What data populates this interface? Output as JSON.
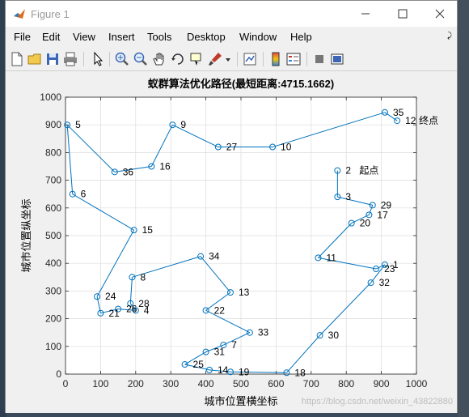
{
  "window": {
    "title": "Figure 1"
  },
  "menu": [
    "File",
    "Edit",
    "View",
    "Insert",
    "Tools",
    "Desktop",
    "Window",
    "Help"
  ],
  "toolbar_icons": [
    "new-figure-icon",
    "open-file-icon",
    "save-icon",
    "print-icon",
    "select-arrow-icon",
    "zoom-in-icon",
    "zoom-out-icon",
    "pan-hand-icon",
    "rotate-3d-icon",
    "data-cursor-icon",
    "brush-icon",
    "brush-dropdown-icon",
    "link-plot-icon",
    "colorbar-icon",
    "legend-icon",
    "hide-plot-tools-icon",
    "show-plot-tools-icon"
  ],
  "watermark": "https://blog.csdn.net/weixin_43822880",
  "chart_data": {
    "type": "line",
    "title": "蚁群算法优化路径(最短距离:4715.1662)",
    "xlabel": "城市位置横坐标",
    "ylabel": "城市位置纵坐标",
    "xlim": [
      0,
      1000
    ],
    "ylim": [
      0,
      1000
    ],
    "xticks": [
      "0",
      "100",
      "200",
      "300",
      "400",
      "500",
      "600",
      "700",
      "800",
      "900",
      "1000"
    ],
    "yticks": [
      "0",
      "100",
      "200",
      "300",
      "400",
      "500",
      "600",
      "700",
      "800",
      "900",
      "1000"
    ],
    "grid": true,
    "marker": "circle",
    "line_color": "#0072bd",
    "start_label": "起点",
    "end_label": "终点",
    "cities": [
      {
        "id": "1",
        "x": 910,
        "y": 395
      },
      {
        "id": "2",
        "x": 775,
        "y": 735
      },
      {
        "id": "3",
        "x": 775,
        "y": 640
      },
      {
        "id": "4",
        "x": 200,
        "y": 230
      },
      {
        "id": "5",
        "x": 5,
        "y": 900
      },
      {
        "id": "6",
        "x": 20,
        "y": 650
      },
      {
        "id": "7",
        "x": 450,
        "y": 105
      },
      {
        "id": "8",
        "x": 190,
        "y": 350
      },
      {
        "id": "9",
        "x": 305,
        "y": 900
      },
      {
        "id": "10",
        "x": 590,
        "y": 820
      },
      {
        "id": "11",
        "x": 720,
        "y": 420
      },
      {
        "id": "12",
        "x": 945,
        "y": 915
      },
      {
        "id": "13",
        "x": 470,
        "y": 295
      },
      {
        "id": "14",
        "x": 410,
        "y": 15
      },
      {
        "id": "15",
        "x": 195,
        "y": 520
      },
      {
        "id": "16",
        "x": 245,
        "y": 750
      },
      {
        "id": "17",
        "x": 865,
        "y": 575
      },
      {
        "id": "18",
        "x": 630,
        "y": 5
      },
      {
        "id": "19",
        "x": 470,
        "y": 8
      },
      {
        "id": "20",
        "x": 815,
        "y": 545
      },
      {
        "id": "21",
        "x": 100,
        "y": 220
      },
      {
        "id": "22",
        "x": 400,
        "y": 230
      },
      {
        "id": "23",
        "x": 885,
        "y": 380
      },
      {
        "id": "24",
        "x": 90,
        "y": 280
      },
      {
        "id": "25",
        "x": 340,
        "y": 35
      },
      {
        "id": "26",
        "x": 150,
        "y": 235
      },
      {
        "id": "27",
        "x": 435,
        "y": 820
      },
      {
        "id": "28",
        "x": 185,
        "y": 255
      },
      {
        "id": "29",
        "x": 875,
        "y": 610
      },
      {
        "id": "30",
        "x": 725,
        "y": 140
      },
      {
        "id": "31",
        "x": 400,
        "y": 80
      },
      {
        "id": "32",
        "x": 870,
        "y": 330
      },
      {
        "id": "33",
        "x": 525,
        "y": 150
      },
      {
        "id": "34",
        "x": 385,
        "y": 425
      },
      {
        "id": "35",
        "x": 910,
        "y": 945
      },
      {
        "id": "36",
        "x": 140,
        "y": 730
      }
    ],
    "route": [
      "2",
      "3",
      "29",
      "17",
      "20",
      "11",
      "23",
      "1",
      "32",
      "30",
      "18",
      "19",
      "14",
      "25",
      "31",
      "7",
      "33",
      "22",
      "13",
      "34",
      "8",
      "28",
      "4",
      "26",
      "21",
      "24",
      "15",
      "6",
      "5",
      "36",
      "16",
      "9",
      "27",
      "10",
      "35",
      "12"
    ]
  }
}
